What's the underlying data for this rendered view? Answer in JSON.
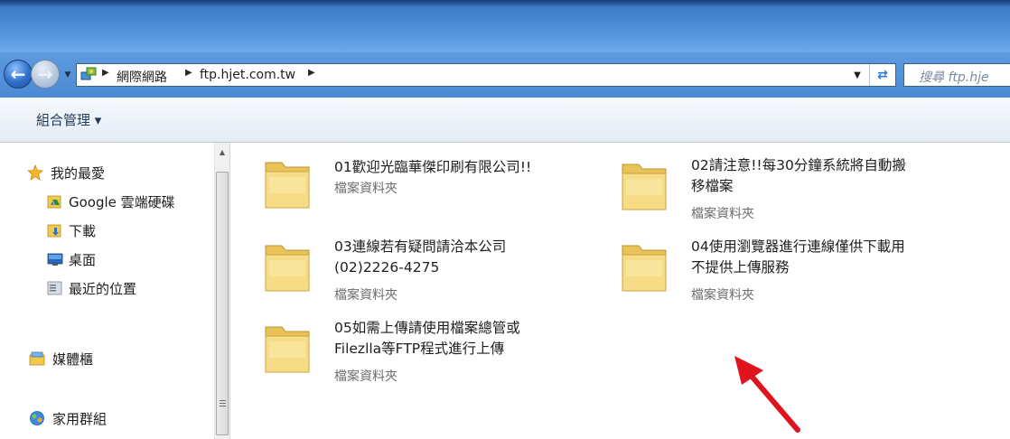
{
  "address_bar": {
    "crumbs": [
      "網際網路",
      "ftp.hjet.com.tw"
    ]
  },
  "search": {
    "placeholder": "搜尋 ftp.hje"
  },
  "toolbar": {
    "organize_label": "組合管理 ▾"
  },
  "sidebar": {
    "items": [
      {
        "label": "我的最愛",
        "icon": "star-icon"
      },
      {
        "label": "Google 雲端硬碟",
        "icon": "google-drive-icon"
      },
      {
        "label": "下載",
        "icon": "download-folder-icon"
      },
      {
        "label": "桌面",
        "icon": "desktop-icon"
      },
      {
        "label": "最近的位置",
        "icon": "recent-places-icon"
      },
      {
        "label": "媒體櫃",
        "icon": "library-icon"
      },
      {
        "label": "家用群組",
        "icon": "homegroup-icon"
      }
    ]
  },
  "folders": [
    {
      "name_lines": [
        "01歡迎光臨華傑印刷有限公司!!"
      ],
      "type": "檔案資料夾"
    },
    {
      "name_lines": [
        "02請注意!!每30分鐘系統將自動搬",
        "移檔案"
      ],
      "type": "檔案資料夾"
    },
    {
      "name_lines": [
        "03連線若有疑問請洽本公司",
        "(02)2226-4275"
      ],
      "type": "檔案資料夾"
    },
    {
      "name_lines": [
        "04使用瀏覽器進行連線僅供下載用",
        "不提供上傳服務"
      ],
      "type": "檔案資料夾"
    },
    {
      "name_lines": [
        "05如需上傳請使用檔案總管或",
        "Filezlla等FTP程式進行上傳"
      ],
      "type": "檔案資料夾"
    }
  ],
  "colors": {
    "annotation_arrow": "#e0141e",
    "folder_yellow": "#f2d77a"
  }
}
